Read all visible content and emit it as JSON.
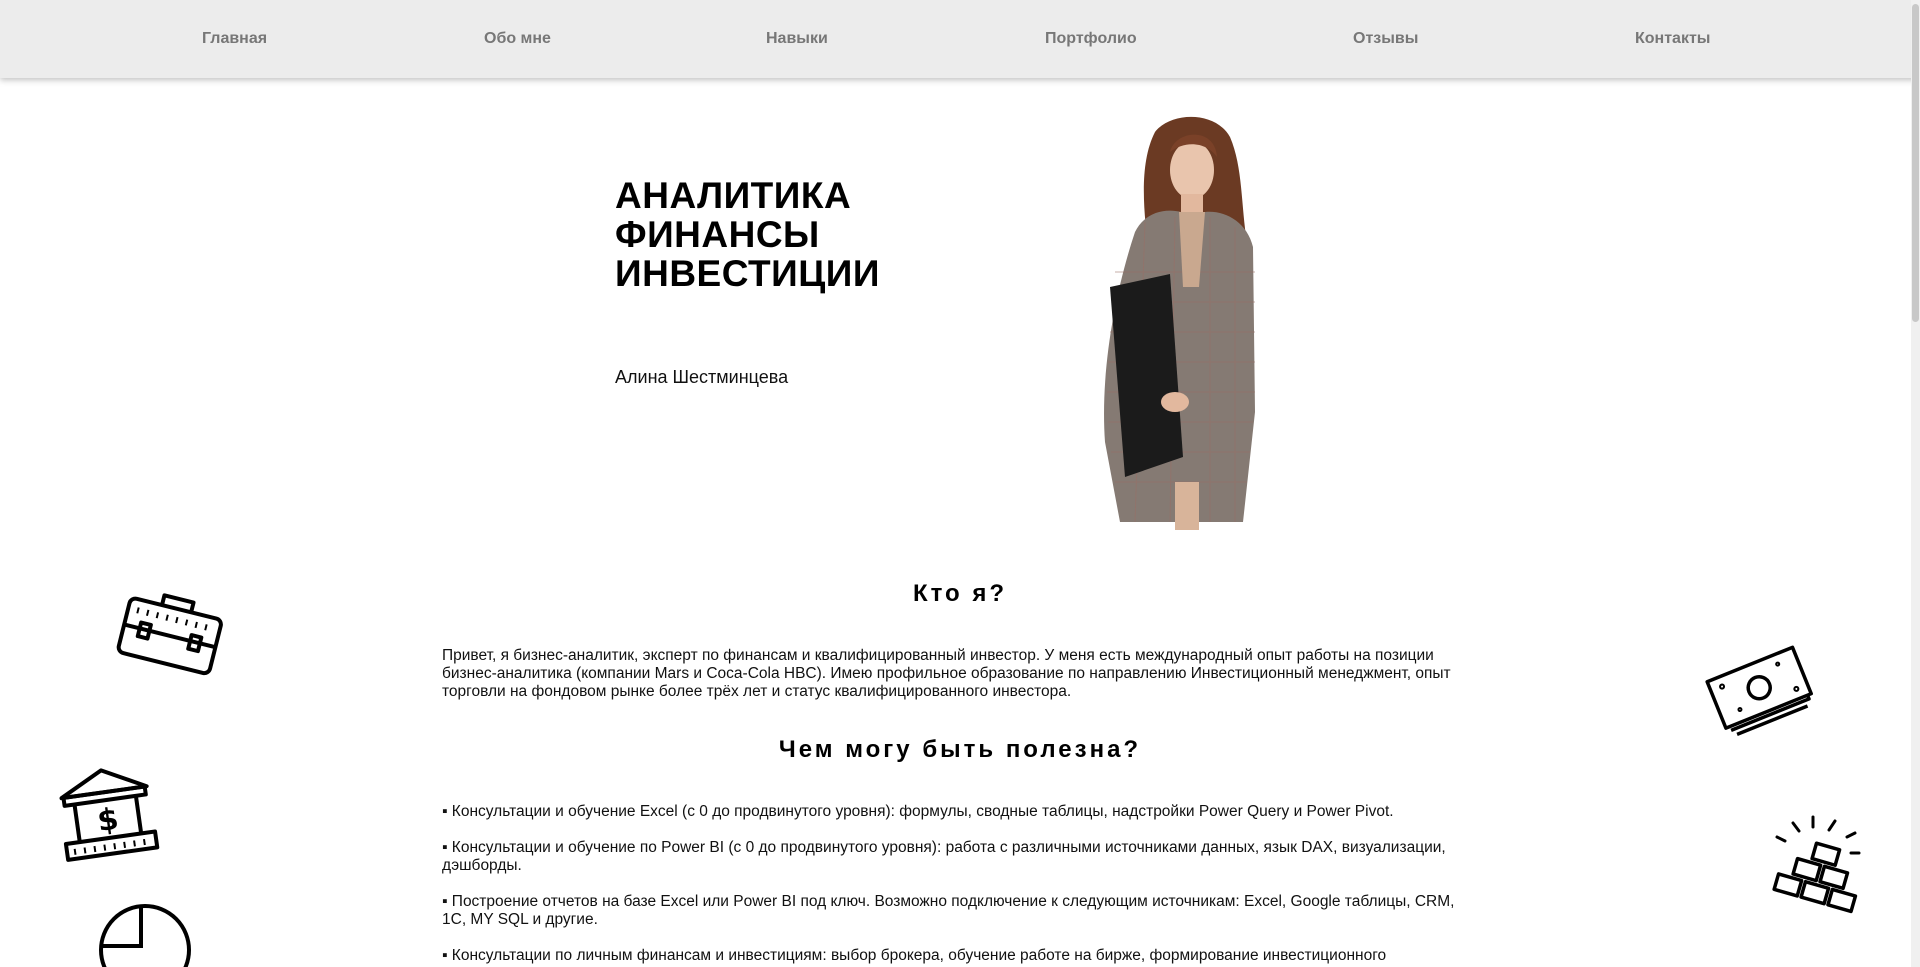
{
  "nav": {
    "items": [
      {
        "label": "Главная"
      },
      {
        "label": "Обо мне"
      },
      {
        "label": "Навыки"
      },
      {
        "label": "Портфолио"
      },
      {
        "label": "Отзывы"
      },
      {
        "label": "Контакты"
      }
    ]
  },
  "hero": {
    "title_lines": [
      "АНАЛИТИКА",
      "ФИНАНСЫ",
      "ИНВЕСТИЦИИ"
    ],
    "name": "Алина Шестминцева"
  },
  "about": {
    "title": "Кто я?",
    "text": "Привет, я бизнес-аналитик, эксперт по финансам и квалифицированный инвестор. У меня есть международный опыт работы на позиции бизнес-аналитика (компании Mars и Coca-Cola HBC). Имею профильное образование по направлению Инвестиционный менеджмент, опыт торговли на фондовом рынке более трёх лет и статус квалифицированного инвестора."
  },
  "services": {
    "title": "Чем могу быть полезна?",
    "items": [
      "▪ Консультации и обучение Excel (с 0 до продвинутого уровня): формулы, сводные таблицы, надстройки Power Query и Power Pivot.",
      "▪ Консультации и обучение по Power BI (с 0 до продвинутого уровня): работа с различными источниками данных, язык DAX, визуализации, дэшборды.",
      "▪ Построение отчетов на базе Excel или Power BI под ключ. Возможно подключение к следующим источникам: Excel, Google таблицы, CRM, 1С, MY SQL и другие.",
      "▪ Консультации по личным финансам и инвестициям: выбор брокера, обучение работе на бирже, формирование инвестиционного"
    ]
  },
  "icons": {
    "left": [
      "briefcase-icon",
      "bank-icon",
      "pie-chart-icon"
    ],
    "right": [
      "money-stack-icon",
      "gold-bars-icon"
    ]
  },
  "colors": {
    "nav_background": "#ececec",
    "nav_text": "#777777",
    "page_background": "#ffffff"
  }
}
